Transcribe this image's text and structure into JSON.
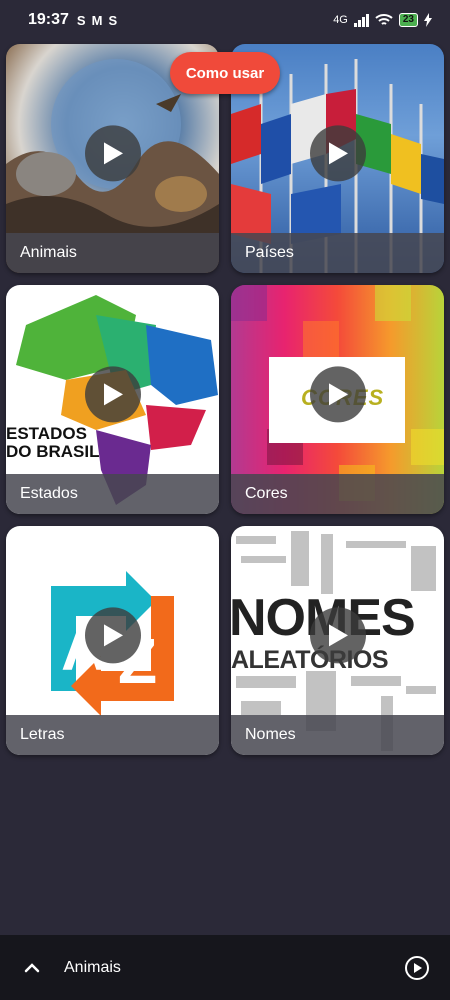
{
  "status": {
    "time": "19:37",
    "notif_icons": [
      "S",
      "M",
      "S"
    ],
    "network": "4G",
    "battery": "23"
  },
  "how_to_button": "Como usar",
  "cards": [
    {
      "label": "Animais"
    },
    {
      "label": "Países"
    },
    {
      "label": "Estados",
      "image_text": "ESTADOS\nDO BRASIL"
    },
    {
      "label": "Cores",
      "image_text": "CORES"
    },
    {
      "label": "Letras",
      "image_text_a": "A",
      "image_text_z": "Z"
    },
    {
      "label": "Nomes",
      "image_text_1": "NOMES",
      "image_text_2": "ALEATÓRIOS"
    }
  ],
  "player": {
    "now_playing": "Animais"
  }
}
